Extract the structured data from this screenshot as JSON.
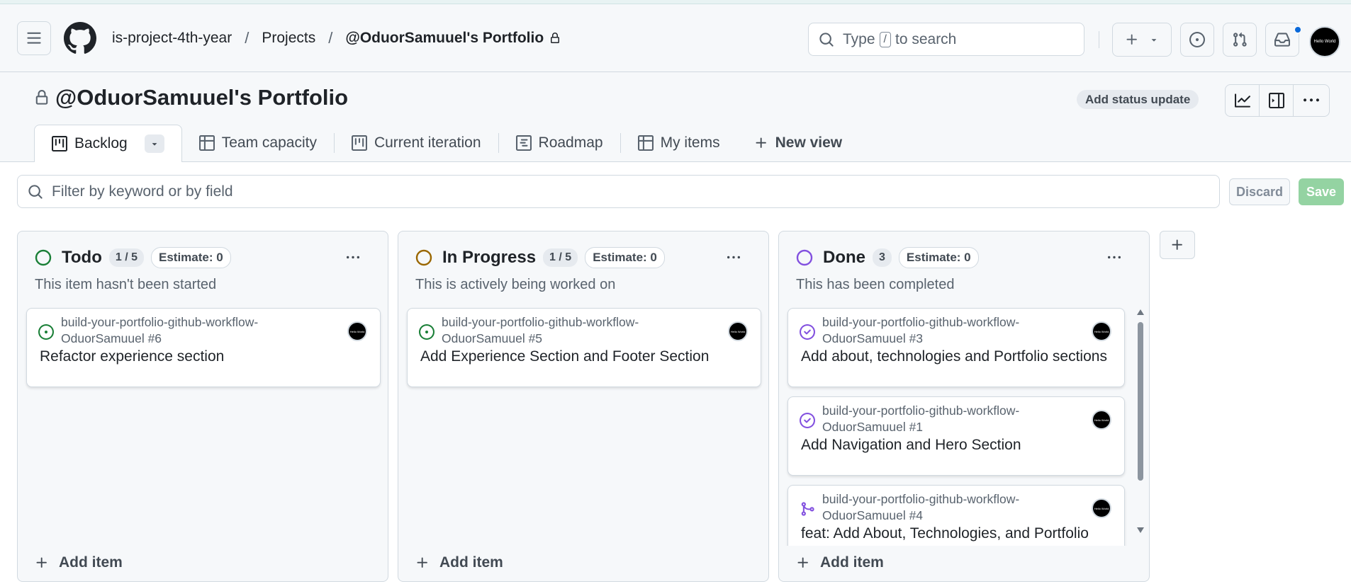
{
  "header": {
    "breadcrumbs": [
      "is-project-4th-year",
      "Projects",
      "@OduorSamuuel's Portfolio"
    ],
    "breadcrumb_separator": "/",
    "search": {
      "prefix": "Type",
      "key": "/",
      "suffix": "to search"
    },
    "icons": [
      "hamburger-icon",
      "github-logo-icon",
      "lock-icon",
      "plus-icon",
      "triangle-down-icon",
      "issues-icon",
      "pull-request-icon",
      "inbox-icon"
    ],
    "avatar_text": "Hello World",
    "notification_color": "#0969da"
  },
  "project": {
    "title": "@OduorSamuuel's Portfolio",
    "status_button": "Add status update"
  },
  "tabs": [
    {
      "label": "Backlog",
      "icon": "board-icon",
      "active": true
    },
    {
      "label": "Team capacity",
      "icon": "table-icon"
    },
    {
      "label": "Current iteration",
      "icon": "board-icon"
    },
    {
      "label": "Roadmap",
      "icon": "roadmap-icon"
    },
    {
      "label": "My items",
      "icon": "table-icon"
    },
    {
      "label": "New view",
      "icon": "plus-icon"
    }
  ],
  "filter": {
    "placeholder": "Filter by keyword or by field",
    "discard_label": "Discard",
    "save_label": "Save"
  },
  "columns": [
    {
      "name": "Todo",
      "count": "1 / 5",
      "estimate": "Estimate: 0",
      "description": "This item hasn't been started",
      "status_color": "#1a7f37",
      "add_item": "Add item",
      "cards": [
        {
          "repo": "build-your-portfolio-github-workflow-OduorSamuuel #6",
          "title": "Refactor experience section",
          "state": "open-issue"
        }
      ]
    },
    {
      "name": "In Progress",
      "count": "1 / 5",
      "estimate": "Estimate: 0",
      "description": "This is actively being worked on",
      "status_color": "#9a6700",
      "add_item": "Add item",
      "cards": [
        {
          "repo": "build-your-portfolio-github-workflow-OduorSamuuel #5",
          "title": "Add Experience Section and Footer Section",
          "state": "open-issue"
        }
      ]
    },
    {
      "name": "Done",
      "count": "3",
      "estimate": "Estimate: 0",
      "description": "This has been completed",
      "status_color": "#8250df",
      "add_item": "Add item",
      "cards": [
        {
          "repo": "build-your-portfolio-github-workflow-OduorSamuuel #3",
          "title": "Add about, technologies and Portfolio sections",
          "state": "closed-issue"
        },
        {
          "repo": "build-your-portfolio-github-workflow-OduorSamuuel #1",
          "title": "Add Navigation and Hero Section",
          "state": "closed-issue"
        },
        {
          "repo": "build-your-portfolio-github-workflow-OduorSamuuel #4",
          "title": "feat: Add About, Technologies, and Portfolio",
          "state": "merged-pr"
        }
      ]
    }
  ]
}
